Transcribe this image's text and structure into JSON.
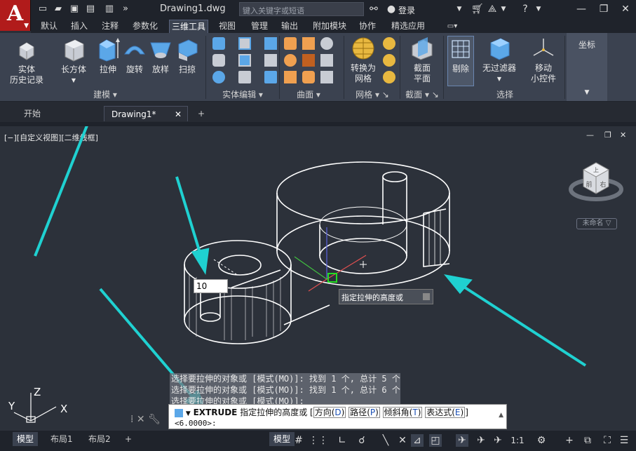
{
  "titlebar": {
    "app_logo": "A",
    "document_title": "Drawing1.dwg",
    "search_placeholder": "键入关键字或短语",
    "login_label": "登录",
    "minimize": "—",
    "restore": "❐",
    "close": "✕"
  },
  "ribbon_tabs": [
    "默认",
    "插入",
    "注释",
    "参数化",
    "三维工具",
    "视图",
    "管理",
    "输出",
    "附加模块",
    "协作",
    "精选应用"
  ],
  "ribbon_active_tab": "三维工具",
  "ribbon": {
    "history_btn": [
      "实体",
      "历史记录"
    ],
    "box_btn": "长方体",
    "extrude_btn": "拉伸",
    "revolve_btn": "旋转",
    "loft_btn": "放样",
    "sweep_btn": "扫掠",
    "modeling_panel": "建模",
    "solid_edit_panel": "实体编辑",
    "surface_panel": "曲面",
    "convert_btn": [
      "转换为",
      "网格"
    ],
    "mesh_panel": "网格",
    "section_btn": [
      "截面",
      "平面"
    ],
    "section_panel": "截面",
    "cull_btn": "剔除",
    "no_filter_btn": "无过滤器",
    "gizmo_btn": [
      "移动",
      "小控件"
    ],
    "selection_panel": "选择",
    "coords_panel": "坐标"
  },
  "doc_tabs": {
    "start": "开始",
    "drawing": "Drawing1*",
    "close": "✕",
    "new": "+"
  },
  "viewport": {
    "label": "[−][自定义视图][二维线框]",
    "viewcube_name": "未命名 ▽",
    "viewcube_top": "上",
    "viewcube_front": "前",
    "viewcube_right": "右",
    "dynamic_input_value": "10",
    "tooltip": "指定拉伸的高度或",
    "win_min": "—",
    "win_restore": "❐",
    "win_close": "✕"
  },
  "history": [
    "选择要拉伸的对象或 [模式(MO)]: 找到 1 个, 总计 5 个",
    "选择要拉伸的对象或 [模式(MO)]: 找到 1 个, 总计 6 个",
    "选择要拉伸的对象或 [模式(MO)]:"
  ],
  "command": {
    "name": "EXTRUDE",
    "text": "指定拉伸的高度或",
    "options": [
      {
        "label": "方向",
        "key": "D"
      },
      {
        "label": "路径",
        "key": "P"
      },
      {
        "label": "倾斜角",
        "key": "T"
      },
      {
        "label": "表达式",
        "key": "E"
      }
    ],
    "prompt": "<6.0000>:"
  },
  "statusbar": {
    "tabs": [
      "模型",
      "布局1",
      "布局2"
    ],
    "add_tab": "+",
    "model_btn": "模型",
    "scale": "1:1"
  },
  "ucs_labels": {
    "x": "X",
    "y": "Y",
    "z": "Z"
  },
  "colors": {
    "accent_cyan": "#1fd1d1",
    "ribbon_bg": "#3b4250",
    "viewport_bg": "#2c313a",
    "logo_red": "#b11b1b"
  }
}
